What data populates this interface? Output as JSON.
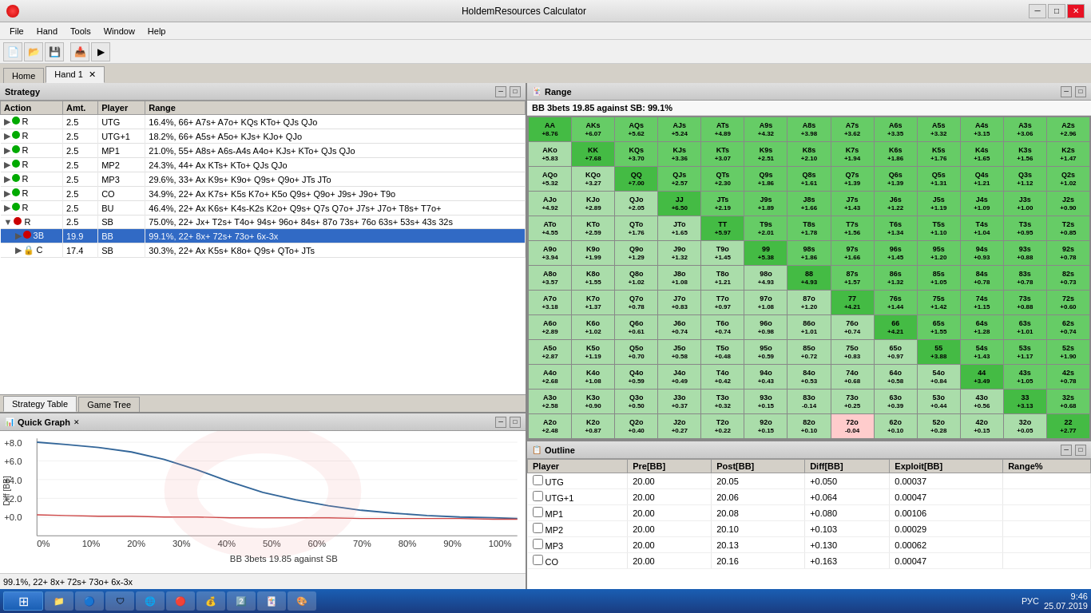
{
  "titleBar": {
    "title": "HoldemResources Calculator",
    "minLabel": "─",
    "maxLabel": "□",
    "closeLabel": "✕"
  },
  "menuBar": {
    "items": [
      "File",
      "Hand",
      "Tools",
      "Window",
      "Help"
    ]
  },
  "tabs": {
    "home": "Home",
    "hand1": "Hand 1"
  },
  "table": {
    "headers": [
      "Action",
      "Amt.",
      "Player",
      "Range"
    ],
    "rows": [
      {
        "type": "R",
        "dot": "green",
        "amt": "2.5",
        "player": "UTG",
        "range": "16.4%, 66+ A7s+ A7o+ KQs KTo+ QJs QJo",
        "expanded": false,
        "indent": 0
      },
      {
        "type": "R",
        "dot": "green",
        "amt": "2.5",
        "player": "UTG+1",
        "range": "18.2%, 66+ A5s+ A5o+ KJs+ KJo+ QJo",
        "expanded": false,
        "indent": 0
      },
      {
        "type": "R",
        "dot": "green",
        "amt": "2.5",
        "player": "MP1",
        "range": "21.0%, 55+ A8s+ A6s-A4s A4o+ KJs+ KTo+ QJs QJo",
        "expanded": false,
        "indent": 0
      },
      {
        "type": "R",
        "dot": "green",
        "amt": "2.5",
        "player": "MP2",
        "range": "24.3%, 44+ Ax KTs+ KTo+ QJs QJo",
        "expanded": false,
        "indent": 0
      },
      {
        "type": "R",
        "dot": "green",
        "amt": "2.5",
        "player": "MP3",
        "range": "29.6%, 33+ Ax K9s+ K9o+ Q9s+ Q9o+ JTs JTo",
        "expanded": false,
        "indent": 0
      },
      {
        "type": "R",
        "dot": "green",
        "amt": "2.5",
        "player": "CO",
        "range": "34.9%, 22+ Ax K7s+ K5s K7o+ K5o Q9s+ Q9o+ J9s+ J9o+ T9o",
        "expanded": false,
        "indent": 0
      },
      {
        "type": "R",
        "dot": "green",
        "amt": "2.5",
        "player": "BU",
        "range": "46.4%, 22+ Ax K6s+ K4s-K2s K2o+ Q9s+ Q7s Q7o+ J7s+ J7o+ T8s+ T7o+",
        "expanded": false,
        "indent": 0
      },
      {
        "type": "R",
        "dot": "red",
        "amt": "2.5",
        "player": "SB",
        "range": "75.0%, 22+ Jx+ T2s+ T4o+ 94s+ 96o+ 84s+ 87o 73s+ 76o 63s+ 53s+ 43s 32s",
        "expanded": true,
        "indent": 0
      },
      {
        "type": "3B",
        "dot": "red",
        "amt": "19.9",
        "player": "BB",
        "range": "99.1%, 22+ 8x+ 72s+ 73o+ 6x-3x",
        "expanded": false,
        "indent": 1,
        "selected": true
      },
      {
        "type": "C",
        "dot": "lock",
        "amt": "17.4",
        "player": "SB",
        "range": "30.3%, 22+ Ax K5s+ K8o+ Q9s+ QTo+ JTs",
        "expanded": false,
        "indent": 1
      }
    ]
  },
  "subTabs": [
    "Strategy Table",
    "Game Tree"
  ],
  "quickGraph": {
    "title": "Quick Graph",
    "subtitle": "BB 3bets 19.85 against SB",
    "statusText": "99.1%, 22+ 8x+ 72s+ 73o+ 6x-3x",
    "yAxisLabel": "Diff [BB]",
    "xAxisLabel": "BB 3bets 19.85 against SB",
    "yMax": 8.0,
    "yMin": 0.0
  },
  "range": {
    "title": "Range",
    "subtitle": "BB 3bets 19.85 against SB: 99.1%",
    "cells": [
      {
        "hand": "AA",
        "ev": "+8.76",
        "type": "pair"
      },
      {
        "hand": "AKs",
        "ev": "+6.07",
        "type": "suited"
      },
      {
        "hand": "AQs",
        "ev": "+5.62",
        "type": "suited"
      },
      {
        "hand": "AJs",
        "ev": "+5.24",
        "type": "suited"
      },
      {
        "hand": "ATs",
        "ev": "+4.89",
        "type": "suited"
      },
      {
        "hand": "A9s",
        "ev": "+4.32",
        "type": "suited"
      },
      {
        "hand": "A8s",
        "ev": "+3.98",
        "type": "suited"
      },
      {
        "hand": "A7s",
        "ev": "+3.62",
        "type": "suited"
      },
      {
        "hand": "A6s",
        "ev": "+3.35",
        "type": "suited"
      },
      {
        "hand": "A5s",
        "ev": "+3.32",
        "type": "suited"
      },
      {
        "hand": "A4s",
        "ev": "+3.15",
        "type": "suited"
      },
      {
        "hand": "A3s",
        "ev": "+3.06",
        "type": "suited"
      },
      {
        "hand": "A2s",
        "ev": "+2.96",
        "type": "suited"
      },
      {
        "hand": "AKo",
        "ev": "+5.83",
        "type": "offsuit"
      },
      {
        "hand": "KK",
        "ev": "+7.68",
        "type": "pair"
      },
      {
        "hand": "KQs",
        "ev": "+3.70",
        "type": "suited"
      },
      {
        "hand": "KJs",
        "ev": "+3.36",
        "type": "suited"
      },
      {
        "hand": "KTs",
        "ev": "+3.07",
        "type": "suited"
      },
      {
        "hand": "K9s",
        "ev": "+2.51",
        "type": "suited"
      },
      {
        "hand": "K8s",
        "ev": "+2.10",
        "type": "suited"
      },
      {
        "hand": "K7s",
        "ev": "+1.94",
        "type": "suited"
      },
      {
        "hand": "K6s",
        "ev": "+1.86",
        "type": "suited"
      },
      {
        "hand": "K5s",
        "ev": "+1.76",
        "type": "suited"
      },
      {
        "hand": "K4s",
        "ev": "+1.65",
        "type": "suited"
      },
      {
        "hand": "K3s",
        "ev": "+1.56",
        "type": "suited"
      },
      {
        "hand": "K2s",
        "ev": "+1.47",
        "type": "suited"
      },
      {
        "hand": "AQo",
        "ev": "+5.32",
        "type": "offsuit"
      },
      {
        "hand": "KQo",
        "ev": "+3.27",
        "type": "offsuit"
      },
      {
        "hand": "QQ",
        "ev": "+7.00",
        "type": "pair"
      },
      {
        "hand": "QJs",
        "ev": "+2.57",
        "type": "suited"
      },
      {
        "hand": "QTs",
        "ev": "+2.30",
        "type": "suited"
      },
      {
        "hand": "Q9s",
        "ev": "+1.86",
        "type": "suited"
      },
      {
        "hand": "Q8s",
        "ev": "+1.61",
        "type": "suited"
      },
      {
        "hand": "Q7s",
        "ev": "+1.39",
        "type": "suited"
      },
      {
        "hand": "Q6s",
        "ev": "+1.39",
        "type": "suited"
      },
      {
        "hand": "Q5s",
        "ev": "+1.31",
        "type": "suited"
      },
      {
        "hand": "Q4s",
        "ev": "+1.21",
        "type": "suited"
      },
      {
        "hand": "Q3s",
        "ev": "+1.12",
        "type": "suited"
      },
      {
        "hand": "Q2s",
        "ev": "+1.02",
        "type": "suited"
      },
      {
        "hand": "AJo",
        "ev": "+4.92",
        "type": "offsuit"
      },
      {
        "hand": "KJo",
        "ev": "+2.89",
        "type": "offsuit"
      },
      {
        "hand": "QJo",
        "ev": "+2.05",
        "type": "offsuit"
      },
      {
        "hand": "JJ",
        "ev": "+6.50",
        "type": "pair"
      },
      {
        "hand": "JTs",
        "ev": "+2.19",
        "type": "suited"
      },
      {
        "hand": "J9s",
        "ev": "+1.89",
        "type": "suited"
      },
      {
        "hand": "J8s",
        "ev": "+1.66",
        "type": "suited"
      },
      {
        "hand": "J7s",
        "ev": "+1.43",
        "type": "suited"
      },
      {
        "hand": "J6s",
        "ev": "+1.22",
        "type": "suited"
      },
      {
        "hand": "J5s",
        "ev": "+1.19",
        "type": "suited"
      },
      {
        "hand": "J4s",
        "ev": "+1.09",
        "type": "suited"
      },
      {
        "hand": "J3s",
        "ev": "+1.00",
        "type": "suited"
      },
      {
        "hand": "J2s",
        "ev": "+0.90",
        "type": "suited"
      },
      {
        "hand": "ATo",
        "ev": "+4.55",
        "type": "offsuit"
      },
      {
        "hand": "KTo",
        "ev": "+2.59",
        "type": "offsuit"
      },
      {
        "hand": "QTo",
        "ev": "+1.76",
        "type": "offsuit"
      },
      {
        "hand": "JTo",
        "ev": "+1.65",
        "type": "offsuit"
      },
      {
        "hand": "TT",
        "ev": "+5.97",
        "type": "pair"
      },
      {
        "hand": "T9s",
        "ev": "+2.01",
        "type": "suited"
      },
      {
        "hand": "T8s",
        "ev": "+1.78",
        "type": "suited"
      },
      {
        "hand": "T7s",
        "ev": "+1.56",
        "type": "suited"
      },
      {
        "hand": "T6s",
        "ev": "+1.34",
        "type": "suited"
      },
      {
        "hand": "T5s",
        "ev": "+1.10",
        "type": "suited"
      },
      {
        "hand": "T4s",
        "ev": "+1.04",
        "type": "suited"
      },
      {
        "hand": "T3s",
        "ev": "+0.95",
        "type": "suited"
      },
      {
        "hand": "T2s",
        "ev": "+0.85",
        "type": "suited"
      },
      {
        "hand": "A9o",
        "ev": "+3.94",
        "type": "offsuit"
      },
      {
        "hand": "K9o",
        "ev": "+1.99",
        "type": "offsuit"
      },
      {
        "hand": "Q9o",
        "ev": "+1.29",
        "type": "offsuit"
      },
      {
        "hand": "J9o",
        "ev": "+1.32",
        "type": "offsuit"
      },
      {
        "hand": "T9o",
        "ev": "+1.45",
        "type": "offsuit"
      },
      {
        "hand": "99",
        "ev": "+5.38",
        "type": "pair"
      },
      {
        "hand": "98s",
        "ev": "+1.86",
        "type": "suited"
      },
      {
        "hand": "97s",
        "ev": "+1.66",
        "type": "suited"
      },
      {
        "hand": "96s",
        "ev": "+1.45",
        "type": "suited"
      },
      {
        "hand": "95s",
        "ev": "+1.20",
        "type": "suited"
      },
      {
        "hand": "94s",
        "ev": "+0.93",
        "type": "suited"
      },
      {
        "hand": "93s",
        "ev": "+0.88",
        "type": "suited"
      },
      {
        "hand": "92s",
        "ev": "+0.78",
        "type": "suited"
      },
      {
        "hand": "A8o",
        "ev": "+3.57",
        "type": "offsuit"
      },
      {
        "hand": "K8o",
        "ev": "+1.55",
        "type": "offsuit"
      },
      {
        "hand": "Q8o",
        "ev": "+1.02",
        "type": "offsuit"
      },
      {
        "hand": "J8o",
        "ev": "+1.08",
        "type": "offsuit"
      },
      {
        "hand": "T8o",
        "ev": "+1.21",
        "type": "offsuit"
      },
      {
        "hand": "98o",
        "ev": "+4.93",
        "type": "offsuit"
      },
      {
        "hand": "88",
        "ev": "+4.93",
        "type": "pair"
      },
      {
        "hand": "87s",
        "ev": "+1.57",
        "type": "suited"
      },
      {
        "hand": "86s",
        "ev": "+1.32",
        "type": "suited"
      },
      {
        "hand": "85s",
        "ev": "+1.05",
        "type": "suited"
      },
      {
        "hand": "84s",
        "ev": "+0.78",
        "type": "suited"
      },
      {
        "hand": "83s",
        "ev": "+0.78",
        "type": "suited"
      },
      {
        "hand": "82s",
        "ev": "+0.73",
        "type": "suited"
      },
      {
        "hand": "A7o",
        "ev": "+3.18",
        "type": "offsuit"
      },
      {
        "hand": "K7o",
        "ev": "+1.37",
        "type": "offsuit"
      },
      {
        "hand": "Q7o",
        "ev": "+0.78",
        "type": "offsuit"
      },
      {
        "hand": "J7o",
        "ev": "+0.83",
        "type": "offsuit"
      },
      {
        "hand": "T7o",
        "ev": "+0.97",
        "type": "offsuit"
      },
      {
        "hand": "97o",
        "ev": "+1.08",
        "type": "offsuit"
      },
      {
        "hand": "87o",
        "ev": "+1.20",
        "type": "offsuit"
      },
      {
        "hand": "77",
        "ev": "+4.21",
        "type": "pair"
      },
      {
        "hand": "76s",
        "ev": "+1.44",
        "type": "suited"
      },
      {
        "hand": "75s",
        "ev": "+1.42",
        "type": "suited"
      },
      {
        "hand": "74s",
        "ev": "+1.15",
        "type": "suited"
      },
      {
        "hand": "73s",
        "ev": "+0.88",
        "type": "suited"
      },
      {
        "hand": "72s",
        "ev": "+0.60",
        "type": "suited"
      },
      {
        "hand": "A6o",
        "ev": "+2.89",
        "type": "offsuit"
      },
      {
        "hand": "K6o",
        "ev": "+1.02",
        "type": "offsuit"
      },
      {
        "hand": "Q6o",
        "ev": "+0.61",
        "type": "offsuit"
      },
      {
        "hand": "J6o",
        "ev": "+0.74",
        "type": "offsuit"
      },
      {
        "hand": "T6o",
        "ev": "+0.74",
        "type": "offsuit"
      },
      {
        "hand": "96o",
        "ev": "+0.98",
        "type": "offsuit"
      },
      {
        "hand": "86o",
        "ev": "+1.01",
        "type": "offsuit"
      },
      {
        "hand": "76o",
        "ev": "+0.74",
        "type": "offsuit"
      },
      {
        "hand": "66",
        "ev": "+4.21",
        "type": "pair"
      },
      {
        "hand": "65s",
        "ev": "+1.55",
        "type": "suited"
      },
      {
        "hand": "64s",
        "ev": "+1.28",
        "type": "suited"
      },
      {
        "hand": "63s",
        "ev": "+1.01",
        "type": "suited"
      },
      {
        "hand": "62s",
        "ev": "+0.74",
        "type": "suited"
      },
      {
        "hand": "A5o",
        "ev": "+2.87",
        "type": "offsuit"
      },
      {
        "hand": "K5o",
        "ev": "+1.19",
        "type": "offsuit"
      },
      {
        "hand": "Q5o",
        "ev": "+0.70",
        "type": "offsuit"
      },
      {
        "hand": "J5o",
        "ev": "+0.58",
        "type": "offsuit"
      },
      {
        "hand": "T5o",
        "ev": "+0.48",
        "type": "offsuit"
      },
      {
        "hand": "95o",
        "ev": "+0.59",
        "type": "offsuit"
      },
      {
        "hand": "85o",
        "ev": "+0.72",
        "type": "offsuit"
      },
      {
        "hand": "75o",
        "ev": "+0.83",
        "type": "offsuit"
      },
      {
        "hand": "65o",
        "ev": "+0.97",
        "type": "offsuit"
      },
      {
        "hand": "55",
        "ev": "+3.88",
        "type": "pair"
      },
      {
        "hand": "54s",
        "ev": "+1.43",
        "type": "suited"
      },
      {
        "hand": "53s",
        "ev": "+1.17",
        "type": "suited"
      },
      {
        "hand": "52s",
        "ev": "+1.90",
        "type": "suited"
      },
      {
        "hand": "A4o",
        "ev": "+2.68",
        "type": "offsuit"
      },
      {
        "hand": "K4o",
        "ev": "+1.08",
        "type": "offsuit"
      },
      {
        "hand": "Q4o",
        "ev": "+0.59",
        "type": "offsuit"
      },
      {
        "hand": "J4o",
        "ev": "+0.49",
        "type": "offsuit"
      },
      {
        "hand": "T4o",
        "ev": "+0.42",
        "type": "offsuit"
      },
      {
        "hand": "94o",
        "ev": "+0.43",
        "type": "offsuit"
      },
      {
        "hand": "84o",
        "ev": "+0.53",
        "type": "offsuit"
      },
      {
        "hand": "74o",
        "ev": "+0.68",
        "type": "offsuit"
      },
      {
        "hand": "64o",
        "ev": "+0.58",
        "type": "offsuit"
      },
      {
        "hand": "54o",
        "ev": "+0.84",
        "type": "offsuit"
      },
      {
        "hand": "44",
        "ev": "+3.49",
        "type": "pair"
      },
      {
        "hand": "43s",
        "ev": "+1.05",
        "type": "suited"
      },
      {
        "hand": "42s",
        "ev": "+0.78",
        "type": "suited"
      },
      {
        "hand": "A3o",
        "ev": "+2.58",
        "type": "offsuit"
      },
      {
        "hand": "K3o",
        "ev": "+0.90",
        "type": "offsuit"
      },
      {
        "hand": "Q3o",
        "ev": "+0.50",
        "type": "offsuit"
      },
      {
        "hand": "J3o",
        "ev": "+0.37",
        "type": "offsuit"
      },
      {
        "hand": "T3o",
        "ev": "+0.32",
        "type": "offsuit"
      },
      {
        "hand": "93o",
        "ev": "+0.15",
        "type": "offsuit"
      },
      {
        "hand": "83o",
        "ev": "-0.14",
        "type": "offsuit"
      },
      {
        "hand": "73o",
        "ev": "+0.25",
        "type": "offsuit"
      },
      {
        "hand": "63o",
        "ev": "+0.39",
        "type": "offsuit"
      },
      {
        "hand": "53o",
        "ev": "+0.44",
        "type": "offsuit"
      },
      {
        "hand": "43o",
        "ev": "+0.56",
        "type": "offsuit"
      },
      {
        "hand": "33",
        "ev": "+3.13",
        "type": "pair"
      },
      {
        "hand": "32s",
        "ev": "+0.68",
        "type": "suited"
      },
      {
        "hand": "A2o",
        "ev": "+2.48",
        "type": "offsuit"
      },
      {
        "hand": "K2o",
        "ev": "+0.87",
        "type": "offsuit"
      },
      {
        "hand": "Q2o",
        "ev": "+0.40",
        "type": "offsuit"
      },
      {
        "hand": "J2o",
        "ev": "+0.27",
        "type": "offsuit"
      },
      {
        "hand": "T2o",
        "ev": "+0.22",
        "type": "offsuit"
      },
      {
        "hand": "92o",
        "ev": "+0.15",
        "type": "offsuit"
      },
      {
        "hand": "82o",
        "ev": "+0.10",
        "type": "offsuit"
      },
      {
        "hand": "72o",
        "ev": "-0.04",
        "type": "pink"
      },
      {
        "hand": "62o",
        "ev": "+0.10",
        "type": "offsuit"
      },
      {
        "hand": "52o",
        "ev": "+0.28",
        "type": "offsuit"
      },
      {
        "hand": "42o",
        "ev": "+0.15",
        "type": "offsuit"
      },
      {
        "hand": "32o",
        "ev": "+0.05",
        "type": "offsuit"
      },
      {
        "hand": "22",
        "ev": "+2.77",
        "type": "pair"
      }
    ]
  },
  "outline": {
    "title": "Outline",
    "headers": [
      "Player",
      "Pre[BB]",
      "Post[BB]",
      "Diff[BB]",
      "Exploit[BB]",
      "Range%"
    ],
    "rows": [
      {
        "player": "UTG",
        "pre": "20.00",
        "post": "20.05",
        "diff": "+0.050",
        "exploit": "0.00037",
        "range": ""
      },
      {
        "player": "UTG+1",
        "pre": "20.00",
        "post": "20.06",
        "diff": "+0.064",
        "exploit": "0.00047",
        "range": ""
      },
      {
        "player": "MP1",
        "pre": "20.00",
        "post": "20.08",
        "diff": "+0.080",
        "exploit": "0.00106",
        "range": ""
      },
      {
        "player": "MP2",
        "pre": "20.00",
        "post": "20.10",
        "diff": "+0.103",
        "exploit": "0.00029",
        "range": ""
      },
      {
        "player": "MP3",
        "pre": "20.00",
        "post": "20.13",
        "diff": "+0.130",
        "exploit": "0.00062",
        "range": ""
      },
      {
        "player": "CO",
        "pre": "20.00",
        "post": "20.16",
        "diff": "+0.163",
        "exploit": "0.00047",
        "range": ""
      }
    ]
  },
  "taskbar": {
    "time": "9:46",
    "date": "25.07.2019",
    "startLabel": "⊞",
    "language": "РУС"
  }
}
